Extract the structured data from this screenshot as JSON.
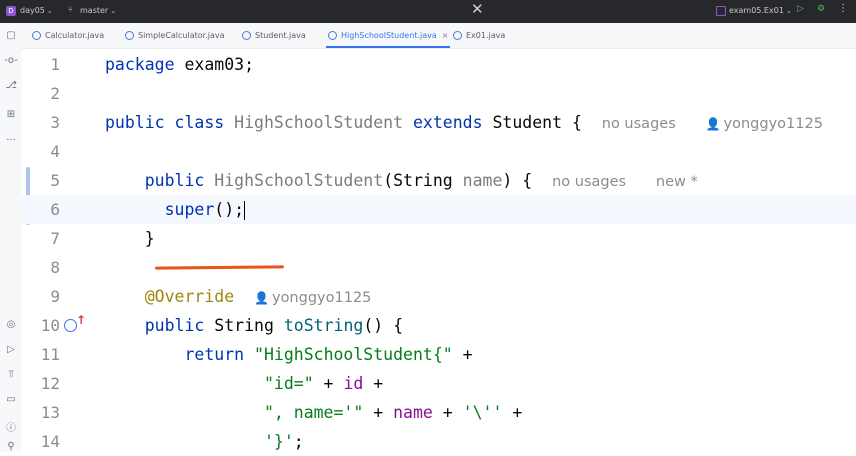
{
  "titlebar": {
    "project_badge": "D",
    "project": "day05",
    "branch": "master",
    "close_glyph": "✕",
    "run_config": "exam05.Ex01",
    "run_glyph": "▷",
    "debug_glyph": "⚙",
    "more_glyph": "⋮"
  },
  "tabs": [
    {
      "label": "Calculator.java",
      "icon": "java-class-icon"
    },
    {
      "label": "SimpleCalculator.java",
      "icon": "java-class-icon"
    },
    {
      "label": "Student.java",
      "icon": "java-class-icon"
    },
    {
      "label": "HighSchoolStudent.java",
      "icon": "java-class-icon",
      "active": true,
      "close": "×"
    },
    {
      "label": "Ex01.java",
      "icon": "java-class-icon"
    }
  ],
  "toolstrip": {
    "top": [
      "▢",
      "-o-",
      "⎇",
      "⊞",
      "···"
    ],
    "bottom": [
      "◎",
      "▷",
      "⫪",
      "▭",
      "ⓘ",
      "⚲"
    ]
  },
  "editor": {
    "line_numbers": [
      "1",
      "2",
      "3",
      "4",
      "5",
      "6",
      "7",
      "8",
      "9",
      "10",
      "11",
      "12",
      "13",
      "14"
    ],
    "line1": {
      "kw": "package",
      "rest": " exam03;"
    },
    "line3": {
      "kw1": "public",
      "kw2": "class",
      "name": "HighSchoolStudent",
      "kw3": "extends",
      "parent": "Student",
      "brace": " {",
      "hint_usages": "no usages",
      "hint_author": "yonggyo1125"
    },
    "line5": {
      "kw": "public",
      "name": "HighSchoolStudent",
      "paren_open": "(",
      "type": "String",
      "param": "name",
      "close": ") {",
      "hint_usages": "no usages",
      "hint_new": "new *"
    },
    "line6": {
      "call": "super",
      "rest": "();"
    },
    "line7": {
      "text": "}"
    },
    "line9": {
      "annotation": "@Override",
      "hint_author": "yonggyo1125"
    },
    "line10": {
      "kw": "public",
      "type": "String",
      "name": "toString",
      "rest": "() {"
    },
    "line11": {
      "kw": "return",
      "str": "\"HighSchoolStudent{\"",
      "rest": " +"
    },
    "line12": {
      "str": "\"id=\"",
      "op": " + ",
      "field": "id",
      "rest": " +"
    },
    "line13": {
      "str": "\", name='\"",
      "op": " + ",
      "field": "name",
      "op2": " + ",
      "char": "'\\''",
      "rest": " +"
    },
    "line14": {
      "char": "'}'",
      "rest": ";"
    }
  },
  "colors": {
    "keyword": "#0033b3",
    "string": "#067d17",
    "field": "#871094",
    "annotation": "#9e880d",
    "accent": "#3574f0",
    "underline_mark": "#e8561b"
  }
}
